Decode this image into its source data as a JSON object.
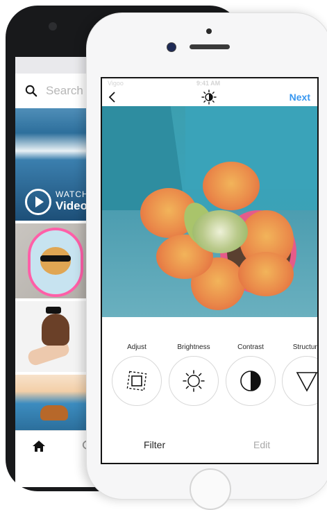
{
  "back_phone": {
    "search_placeholder": "Search",
    "video_tile": {
      "watch_label": "WATCH",
      "video_label": "Video"
    }
  },
  "front_phone": {
    "status": {
      "carrier": "Vigoo",
      "time": "9:41 AM"
    },
    "nav": {
      "next_label": "Next"
    },
    "tools": [
      {
        "label": "Adjust",
        "icon": "adjust-icon"
      },
      {
        "label": "Brightness",
        "icon": "brightness-icon"
      },
      {
        "label": "Contrast",
        "icon": "contrast-icon"
      },
      {
        "label": "Structure",
        "icon": "structure-icon"
      }
    ],
    "tabs": {
      "filter_label": "Filter",
      "edit_label": "Edit"
    }
  },
  "colors": {
    "accent_blue": "#3897f0",
    "text_dark": "#262626",
    "text_muted": "#a8a8a8"
  }
}
